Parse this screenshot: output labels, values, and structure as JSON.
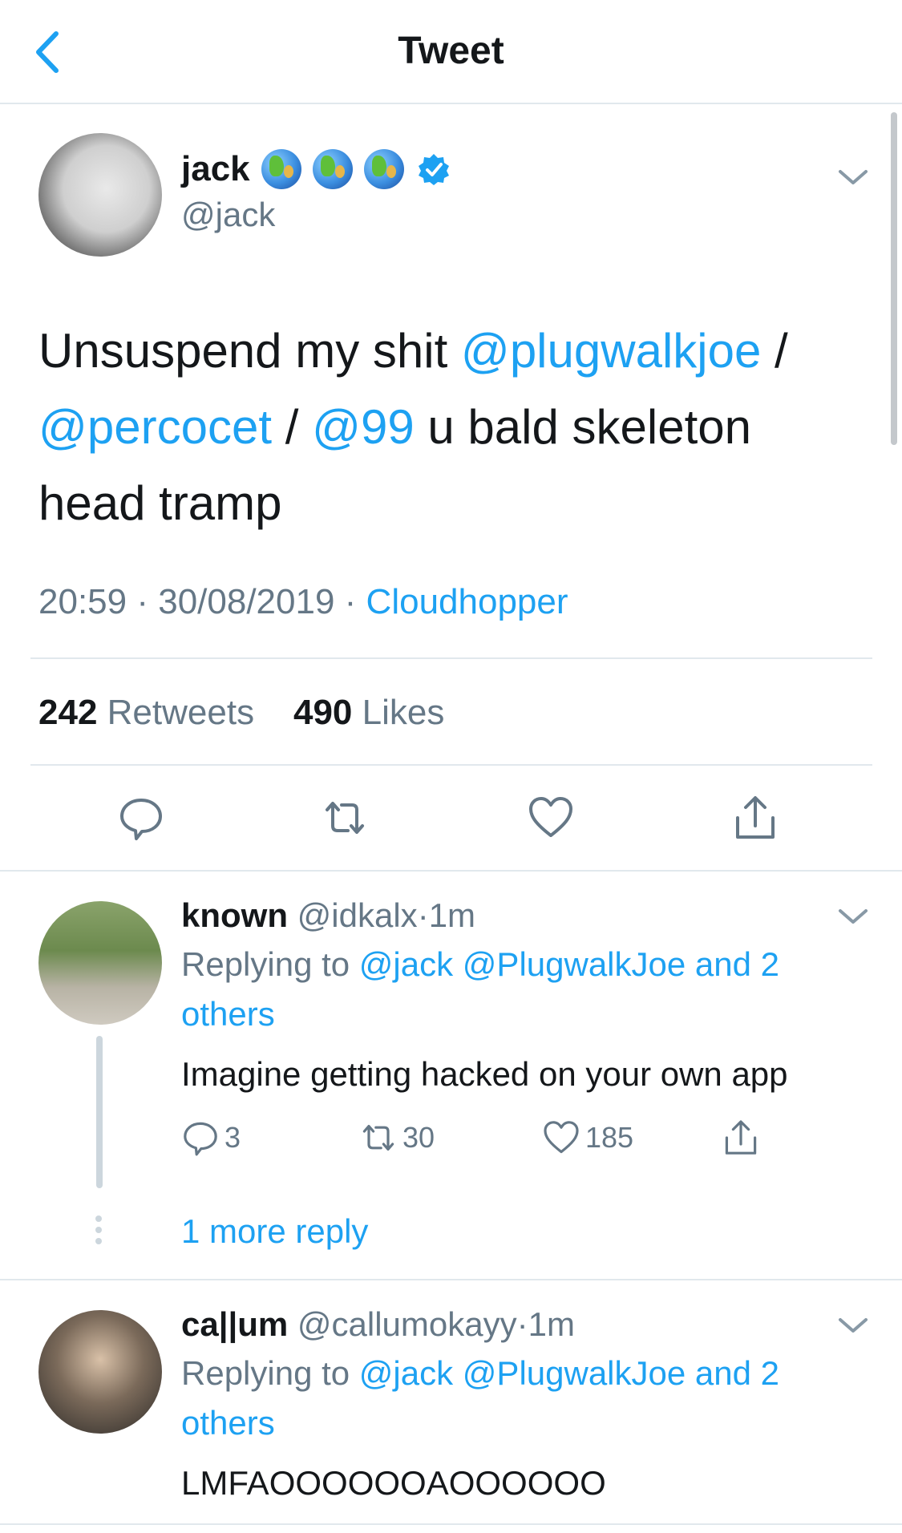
{
  "header": {
    "title": "Tweet"
  },
  "tweet": {
    "name": "jack",
    "handle": "@jack",
    "text_part1": "Unsuspend my shit ",
    "mention1": "@plugwalkjoe",
    "text_part2": " / ",
    "mention2": "@percocet",
    "text_part3": " / ",
    "mention3": "@99",
    "text_part4": " u bald skeleton head tramp",
    "time": "20:59",
    "date": "30/08/2019",
    "sep": " · ",
    "source": "Cloudhopper",
    "retweets_count": "242",
    "retweets_label": "Retweets",
    "likes_count": "490",
    "likes_label": "Likes"
  },
  "replies": [
    {
      "name": "known",
      "handle": "@idkalx",
      "time": "1m",
      "replying_prefix": "Replying to ",
      "replying_to": "@jack @PlugwalkJoe and 2 others",
      "text": "Imagine getting hacked on your own app",
      "reply_count": "3",
      "retweet_count": "30",
      "like_count": "185",
      "more_replies": "1 more reply"
    },
    {
      "name": "ca||um",
      "handle": "@callumokayy",
      "time": "1m",
      "replying_prefix": "Replying to ",
      "replying_to": "@jack @PlugwalkJoe and 2 others",
      "text": "LMFAOOOOOOAOOOOOO"
    }
  ],
  "colors": {
    "accent": "#1da1f2",
    "secondary_text": "#657786",
    "divider": "#e1e8ed"
  },
  "icons": {
    "back": "chevron-left-icon",
    "verified": "verified-badge-icon",
    "globe": "globe-emoji-icon",
    "more": "chevron-down-icon",
    "reply": "reply-icon",
    "retweet": "retweet-icon",
    "like": "heart-icon",
    "share": "share-icon"
  }
}
